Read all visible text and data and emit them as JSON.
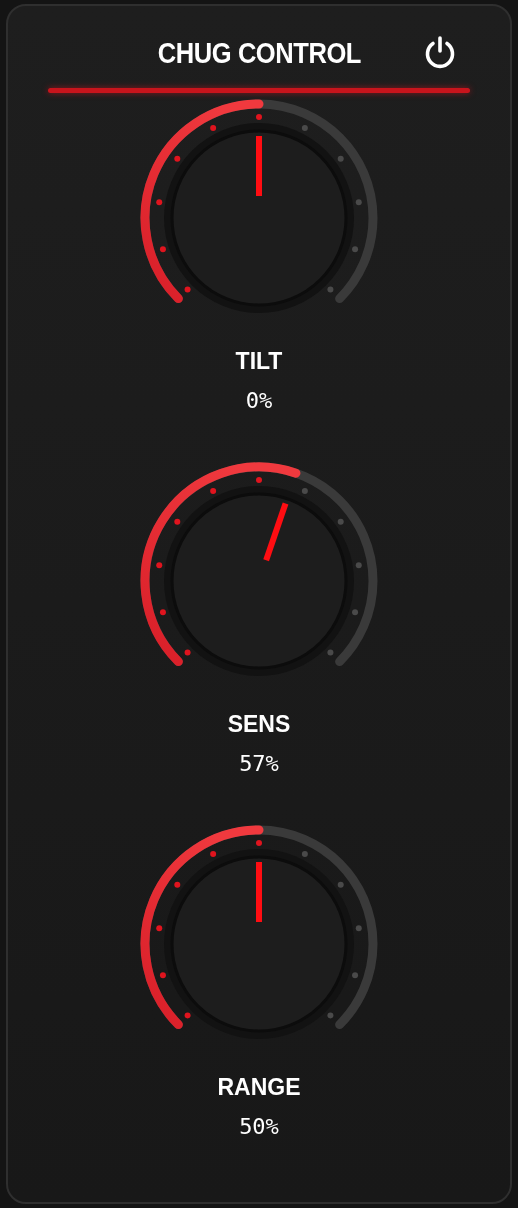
{
  "title": "CHUG CONTROL",
  "knobs": [
    {
      "label": "TILT",
      "value": "0%"
    },
    {
      "label": "SENS",
      "value": "57%"
    },
    {
      "label": "RANGE",
      "value": "50%"
    }
  ]
}
